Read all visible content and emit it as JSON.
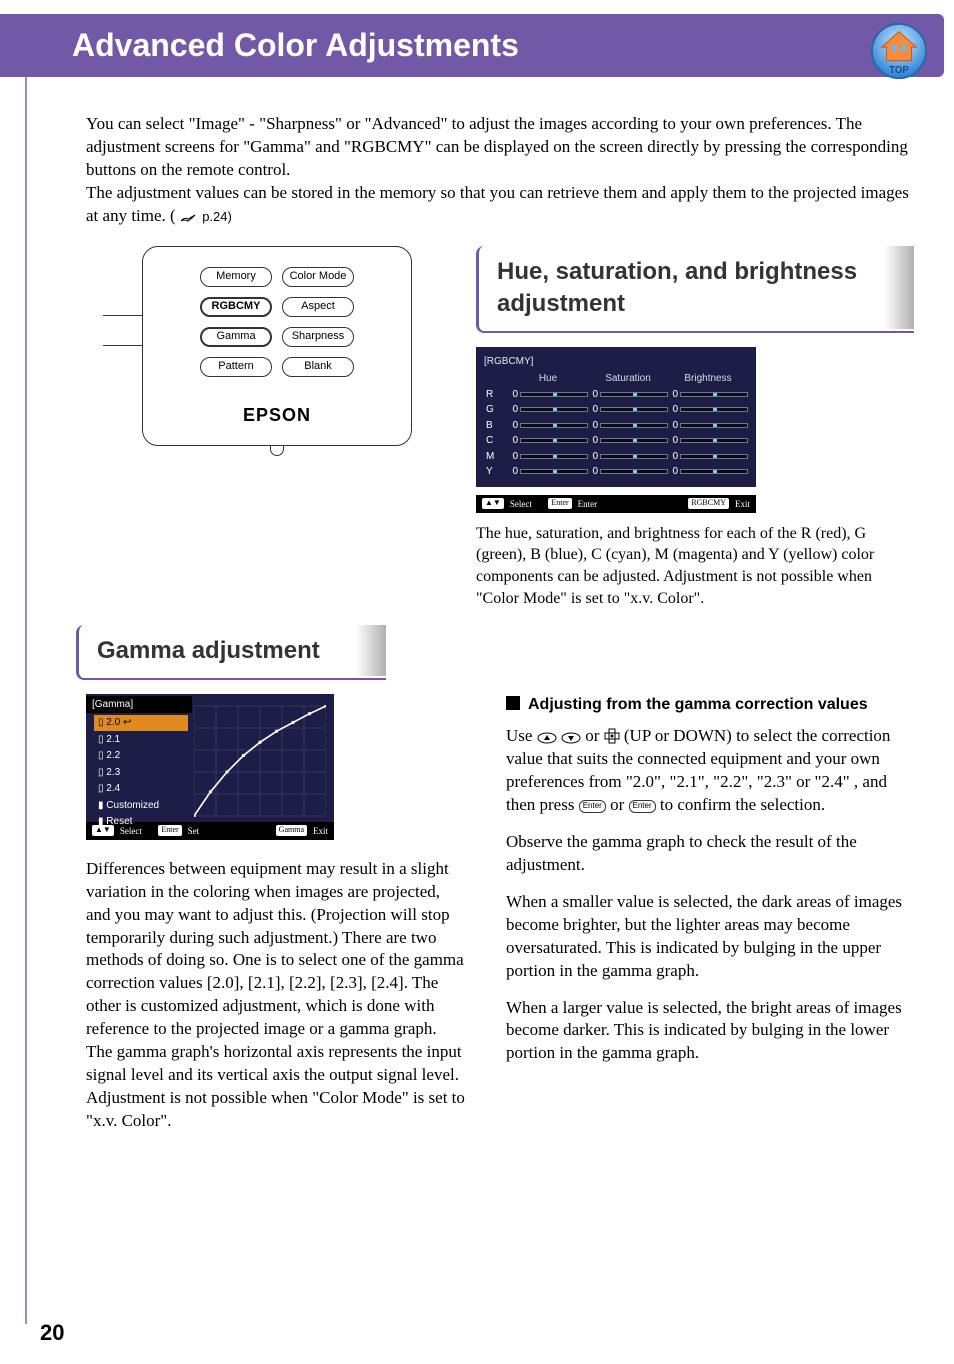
{
  "header": {
    "title": "Advanced Color Adjustments",
    "top_label": "TOP"
  },
  "intro": {
    "p1": "You can select \"Image\" - \"Sharpness\" or \"Advanced\" to adjust the images according to your own preferences. The adjustment screens for \"Gamma\" and \"RGBCMY\" can be displayed on the screen directly by pressing the corresponding buttons on the remote control.",
    "p2a": "The adjustment values can be stored in the memory so that you can retrieve them and apply them to the projected images at any time. (",
    "p2b": " p.24)"
  },
  "remote": {
    "buttons": [
      [
        "Memory",
        "Color Mode"
      ],
      [
        "RGBCMY",
        "Aspect"
      ],
      [
        "Gamma",
        "Sharpness"
      ],
      [
        "Pattern",
        "Blank"
      ]
    ],
    "brand": "EPSON"
  },
  "hsb": {
    "title": "Hue, saturation, and brightness adjustment",
    "osd_title": "[RGBCMY]",
    "cols": [
      "Hue",
      "Saturation",
      "Brightness"
    ],
    "rows": [
      "R",
      "G",
      "B",
      "C",
      "M",
      "Y"
    ],
    "value": "0",
    "foot_select": "Select",
    "foot_enter_key": "Enter",
    "foot_enter": "Enter",
    "foot_exit_key": "RGBCMY",
    "foot_exit": "Exit",
    "desc": "The hue, saturation, and brightness for each of the R (red), G (green), B (blue), C (cyan), M (magenta) and Y (yellow) color components can be adjusted. Adjustment is not possible when \"Color Mode\" is set to \"x.v. Color\"."
  },
  "gamma": {
    "title": "Gamma adjustment",
    "osd_title": "[Gamma]",
    "items": [
      "2.0",
      "2.1",
      "2.2",
      "2.3",
      "2.4",
      "Customized",
      "Reset"
    ],
    "foot_select": "Select",
    "foot_set_key": "Enter",
    "foot_set": "Set",
    "foot_exit_key": "Gamma",
    "foot_exit": "Exit",
    "left_desc": "Differences between equipment may result in a slight variation in the coloring when images are projected, and you may want to adjust this. (Projection will stop temporarily during such adjustment.) There are two methods of doing so. One is to select one of the gamma correction values [2.0], [2.1], [2.2], [2.3], [2.4]. The other is customized adjustment, which is done with reference to the projected image or a gamma graph. The gamma graph's horizontal axis represents the input signal level and its vertical axis the output signal level.",
    "left_desc2": "Adjustment is not possible when \"Color Mode\" is set to \"x.v. Color\".",
    "sub_title": "Adjusting from the gamma correction values",
    "r1a": "Use ",
    "r1b": " or ",
    "r1c": " (UP or DOWN) to select the correction value that suits the connected equipment and your own preferences from \"2.0\", \"2.1\", \"2.2\", \"2.3\" or \"2.4\" , and then press ",
    "r1d": " or ",
    "r1e": " to confirm the selection.",
    "enter_key": "Enter",
    "r2": "Observe the gamma graph to check the result of the adjustment.",
    "r3": "When a smaller value is selected, the dark areas of images become brighter, but the lighter areas may become oversaturated. This is indicated by bulging in the upper portion in the gamma graph.",
    "r4": "When a larger value is selected, the bright areas of images become darker. This is indicated by bulging in the lower portion in the gamma graph."
  },
  "page_number": "20"
}
